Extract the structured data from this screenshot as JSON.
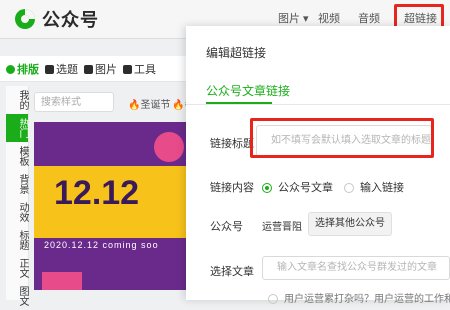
{
  "app": {
    "logo_text": "公众号"
  },
  "topnav": [
    {
      "label": "图片 ▾"
    },
    {
      "label": "视频"
    },
    {
      "label": "音频"
    },
    {
      "label": "超链接"
    }
  ],
  "toolbar": [
    {
      "label": "排版"
    },
    {
      "label": "选题"
    },
    {
      "label": "图片"
    },
    {
      "label": "工具"
    }
  ],
  "sidebar": [
    {
      "label": "我的"
    },
    {
      "label": "热门"
    },
    {
      "label": "模板"
    },
    {
      "label": "背景"
    },
    {
      "label": "动效"
    },
    {
      "label": "标题"
    },
    {
      "label": "正文"
    },
    {
      "label": "图文"
    }
  ],
  "search": {
    "placeholder": "搜索样式"
  },
  "tags": [
    {
      "label": "圣诞节"
    },
    {
      "label": "冬"
    }
  ],
  "banner": {
    "big_text": "12.12",
    "sub_text": "2020.12.12 coming soo"
  },
  "dialog": {
    "title": "编辑超链接",
    "tab": "公众号文章链接",
    "link_title_label": "链接标题",
    "link_title_placeholder": "如不填写会默认填入选取文章的标题",
    "content_label": "链接内容",
    "option_article": "公众号文章",
    "option_link": "输入链接",
    "account_label": "公众号",
    "account_value": "运营晋阻",
    "other_account_button": "选择其他公众号",
    "select_article_label": "选择文章",
    "select_article_placeholder": "输入文章名查找公众号群发过的文章",
    "bottom_text": "用户运营累打杂吗？用户运营的工作和职"
  },
  "highlight_color": "#e8251c",
  "accent_color": "#1aad19"
}
